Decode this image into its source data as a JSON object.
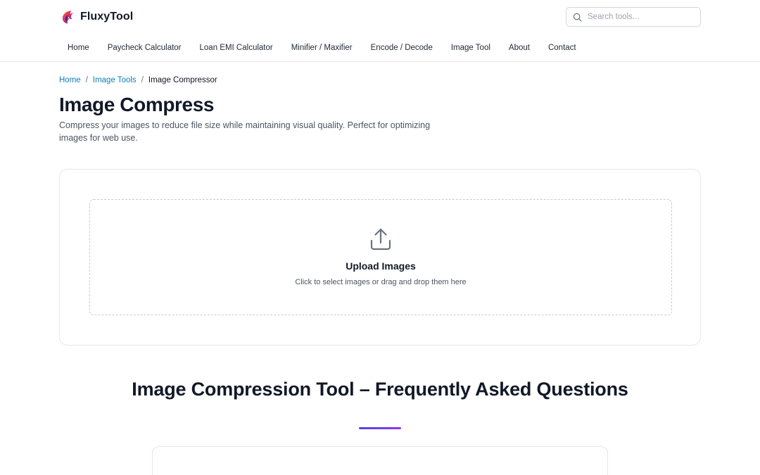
{
  "brand": {
    "name": "FluxyTool"
  },
  "search": {
    "placeholder": "Search tools..."
  },
  "nav": {
    "items": [
      {
        "label": "Home"
      },
      {
        "label": "Paycheck Calculator"
      },
      {
        "label": "Loan EMI Calculator"
      },
      {
        "label": "Minifier / Maxifier"
      },
      {
        "label": "Encode / Decode"
      },
      {
        "label": "Image Tool"
      },
      {
        "label": "About"
      },
      {
        "label": "Contact"
      }
    ]
  },
  "breadcrumb": {
    "items": [
      {
        "label": "Home"
      },
      {
        "label": "Image Tools"
      },
      {
        "label": "Image Compressor"
      }
    ],
    "separator": "/"
  },
  "page": {
    "title": "Image Compress",
    "description": "Compress your images to reduce file size while maintaining visual quality. Perfect for optimizing images for web use."
  },
  "upload": {
    "icon": "upload-icon",
    "title": "Upload Images",
    "hint": "Click to select images or drag and drop them here"
  },
  "faq": {
    "title": "Image Compression Tool – Frequently Asked Questions"
  },
  "colors": {
    "link": "#0e7fb8",
    "accent_start": "#4f46e5",
    "accent_end": "#9333ea"
  }
}
